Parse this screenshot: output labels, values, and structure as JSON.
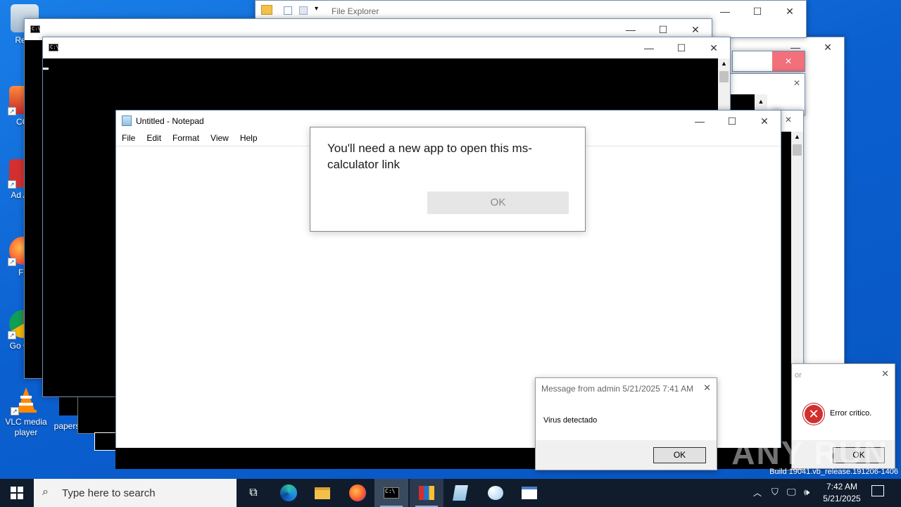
{
  "desktop": {
    "icons": [
      {
        "label": "Recy"
      },
      {
        "label": "CCl"
      },
      {
        "label": "Ad Acr"
      },
      {
        "label": "Fir"
      },
      {
        "label": "Go Chr"
      },
      {
        "label": "VLC media player"
      },
      {
        "label": "papers"
      }
    ],
    "build_text": "Build 19041.vb_release.191206-1406",
    "watermark": "ANY RUN"
  },
  "file_explorer": {
    "title": "File Explorer"
  },
  "notepad": {
    "title": "Untitled - Notepad",
    "menu": [
      "File",
      "Edit",
      "Format",
      "View",
      "Help"
    ]
  },
  "app_dialog": {
    "message": "You'll need a new app to open this ms-calculator link",
    "ok_label": "OK"
  },
  "msg_dialog": {
    "title": "Message from admin 5/21/2025 7:41 AM",
    "message": "Virus detectado",
    "ok_label": "OK"
  },
  "error_dialog": {
    "title_fragment": "or",
    "message": "Error critico.",
    "ok_label": "OK"
  },
  "taskbar": {
    "search_placeholder": "Type here to search",
    "time": "7:42 AM",
    "date": "5/21/2025"
  },
  "colors": {
    "desktop": "#0b5fcf",
    "taskbar": "#101c2c",
    "accent": "#0078d7",
    "error_red": "#d32f2f"
  }
}
